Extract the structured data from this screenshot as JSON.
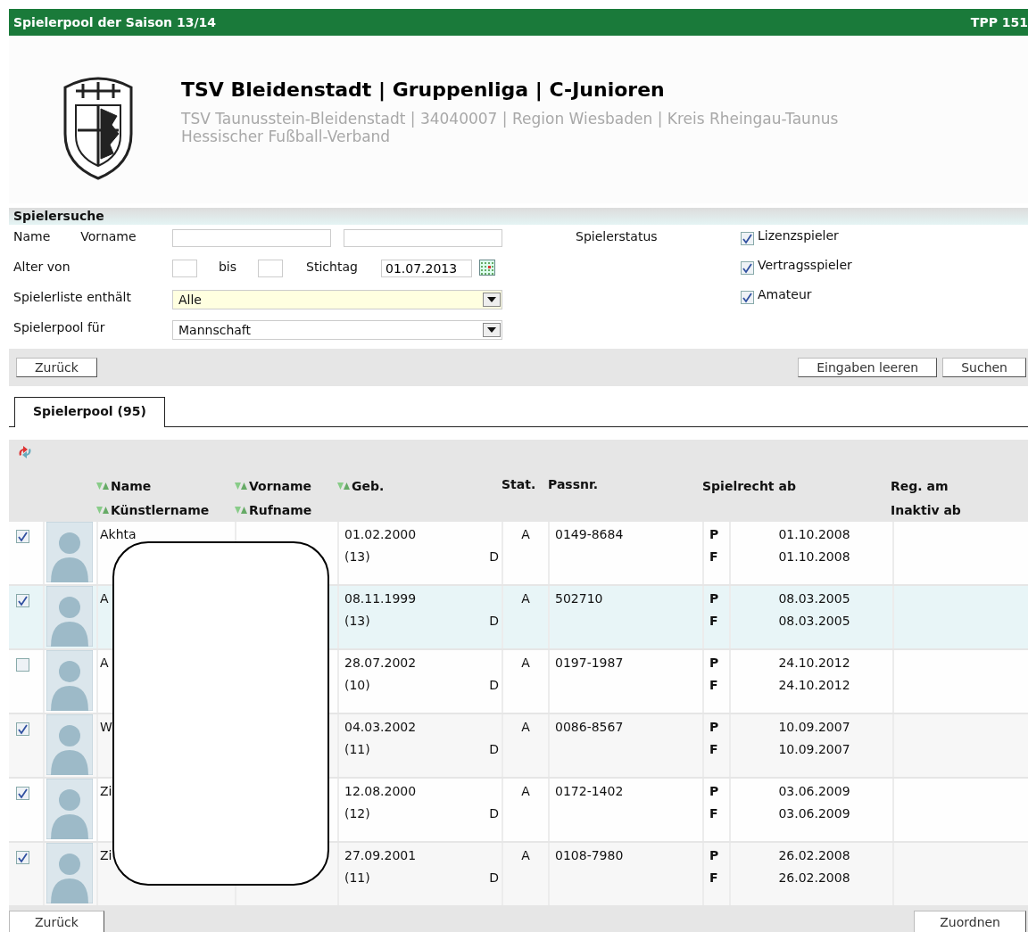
{
  "title_bar": {
    "title": "Spielerpool der Saison 13/14",
    "code": "TPP 151"
  },
  "club": {
    "heading": "TSV Bleidenstadt | Gruppenliga | C-Junioren",
    "line1": "TSV Taunusstein-Bleidenstadt | 34040007 | Region Wiesbaden | Kreis Rheingau-Taunus",
    "line2": "Hessischer Fußball-Verband"
  },
  "search": {
    "title": "Spielersuche",
    "name_label": "Name",
    "vorname_label": "Vorname",
    "age_label": "Alter von",
    "to_label": "bis",
    "date_label": "Stichtag",
    "date_value": "01.07.2013",
    "list_label": "Spielerliste enthält",
    "list_value": "Alle",
    "pool_label": "Spielerpool für",
    "pool_value": "Mannschaft",
    "status_label": "Spielerstatus",
    "status": [
      {
        "label": "Lizenzspieler",
        "checked": true
      },
      {
        "label": "Vertragsspieler",
        "checked": true
      },
      {
        "label": "Amateur",
        "checked": true
      }
    ],
    "back_button": "Zurück",
    "clear_button": "Eingaben leeren",
    "search_button": "Suchen"
  },
  "tabs": [
    {
      "label": "Spielerpool (95)",
      "selected": true
    }
  ],
  "columns": [
    {
      "top": "Name",
      "bottom": "Künstlername",
      "sortable": true
    },
    {
      "top": "Vorname",
      "bottom": "Rufname",
      "sortable": true
    },
    {
      "top": "Geb.",
      "sortable": true
    },
    {
      "top": "Stat.",
      "sortable": false
    },
    {
      "top": "Passnr.",
      "sortable": false
    },
    {
      "top": "Spielrecht ab",
      "sortable": false
    },
    {
      "top": "Reg. am",
      "bottom": "Inaktiv ab",
      "sortable": false
    }
  ],
  "rows": [
    {
      "checked": true,
      "highlighted": false,
      "name": "Akhta",
      "birth": "01.02.2000",
      "age": "(13)",
      "nation": "D",
      "status": "A",
      "pass": "0149-8684",
      "rights": [
        {
          "type": "P",
          "date": "01.10.2008"
        },
        {
          "type": "F",
          "date": "01.10.2008"
        }
      ]
    },
    {
      "checked": true,
      "highlighted": true,
      "name": "A",
      "birth": "08.11.1999",
      "age": "(13)",
      "nation": "D",
      "status": "A",
      "pass": "502710",
      "rights": [
        {
          "type": "P",
          "date": "08.03.2005"
        },
        {
          "type": "F",
          "date": "08.03.2005"
        }
      ]
    },
    {
      "checked": false,
      "highlighted": false,
      "name": "A",
      "birth": "28.07.2002",
      "age": "(10)",
      "nation": "D",
      "status": "A",
      "pass": "0197-1987",
      "rights": [
        {
          "type": "P",
          "date": "24.10.2012"
        },
        {
          "type": "F",
          "date": "24.10.2012"
        }
      ]
    },
    {
      "checked": true,
      "highlighted": false,
      "name": "W",
      "birth": "04.03.2002",
      "age": "(11)",
      "nation": "D",
      "status": "A",
      "pass": "0086-8567",
      "rights": [
        {
          "type": "P",
          "date": "10.09.2007"
        },
        {
          "type": "F",
          "date": "10.09.2007"
        }
      ]
    },
    {
      "checked": true,
      "highlighted": false,
      "name": "Zi",
      "birth": "12.08.2000",
      "age": "(12)",
      "nation": "D",
      "status": "A",
      "pass": "0172-1402",
      "rights": [
        {
          "type": "P",
          "date": "03.06.2009"
        },
        {
          "type": "F",
          "date": "03.06.2009"
        }
      ]
    },
    {
      "checked": true,
      "highlighted": false,
      "name": "Zi",
      "birth": "27.09.2001",
      "age": "(11)",
      "nation": "D",
      "status": "A",
      "pass": "0108-7980",
      "rights": [
        {
          "type": "P",
          "date": "26.02.2008"
        },
        {
          "type": "F",
          "date": "26.02.2008"
        }
      ]
    }
  ],
  "footer": {
    "back_button": "Zurück",
    "assign_button": "Zuordnen"
  }
}
